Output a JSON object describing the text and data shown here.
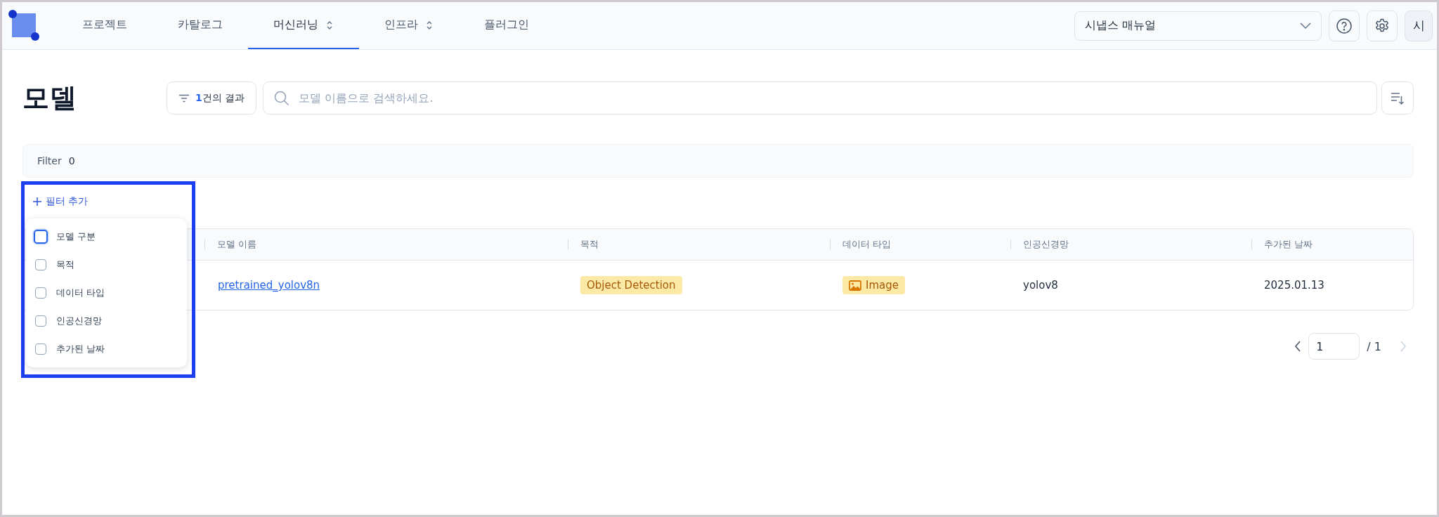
{
  "nav": {
    "tabs": [
      {
        "label": "프로젝트",
        "selected": false,
        "has_menu": false
      },
      {
        "label": "카탈로그",
        "selected": false,
        "has_menu": false
      },
      {
        "label": "머신러닝",
        "selected": true,
        "has_menu": true
      },
      {
        "label": "인프라",
        "selected": false,
        "has_menu": true
      },
      {
        "label": "플러그인",
        "selected": false,
        "has_menu": false
      }
    ]
  },
  "workspace_select": {
    "value": "시냅스 매뉴얼"
  },
  "avatar": {
    "initial": "시"
  },
  "page": {
    "title": "모델",
    "result_count": "1",
    "result_suffix": "건의 결과",
    "search_placeholder": "모델 이름으로 검색하세요."
  },
  "filter_bar": {
    "label": "Filter",
    "count": "0"
  },
  "add_filter": {
    "label": "필터 추가"
  },
  "filter_menu": {
    "items": [
      {
        "label": "모델 구분",
        "checked": false,
        "focused": true
      },
      {
        "label": "목적",
        "checked": false,
        "focused": false
      },
      {
        "label": "데이터 타입",
        "checked": false,
        "focused": false
      },
      {
        "label": "인공신경망",
        "checked": false,
        "focused": false
      },
      {
        "label": "추가된 날짜",
        "checked": false,
        "focused": false
      }
    ]
  },
  "table": {
    "columns": [
      "모델 이름",
      "목적",
      "데이터 타입",
      "인공신경망",
      "추가된 날짜"
    ],
    "rows": [
      {
        "model_name": "pretrained_yolov8n",
        "purpose": "Object Detection",
        "data_type": "Image",
        "network": "yolov8",
        "added": "2025.01.13"
      }
    ]
  },
  "pagination": {
    "page": "1",
    "total": "/ 1"
  }
}
